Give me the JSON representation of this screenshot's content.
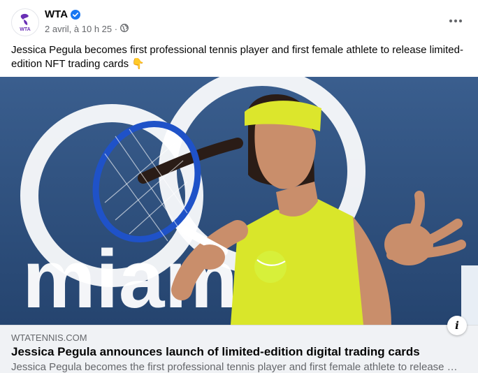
{
  "post": {
    "page_name": "WTA",
    "verified": true,
    "timestamp": "2 avril, à 10 h 25 ·",
    "audience_icon": "globe-icon",
    "caption": "Jessica Pegula becomes first professional tennis player and first female athlete to release limited-edition NFT trading cards",
    "caption_emoji": "👇"
  },
  "avatar": {
    "logo_text": "WTA",
    "brand_color": "#6a2fb5"
  },
  "photo": {
    "sign_text": "miam"
  },
  "link_preview": {
    "domain": "WTATENNIS.COM",
    "title": "Jessica Pegula announces launch of limited-edition digital trading cards",
    "description": "Jessica Pegula becomes the first professional tennis player and first female athlete to release li..."
  },
  "colors": {
    "verified_blue": "#1877f2",
    "photo_bg": "#2f4f7c",
    "shirt": "#d9e62a"
  }
}
